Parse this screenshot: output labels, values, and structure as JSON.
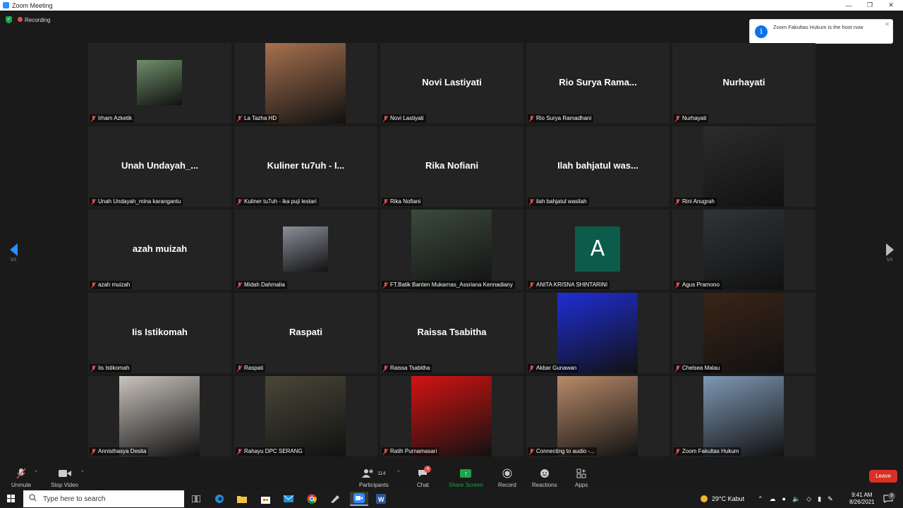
{
  "window": {
    "title": "Zoom Meeting"
  },
  "meeting": {
    "recording_label": "Recording",
    "notification": "Zoom Fakultas Hukum is the host now",
    "page_left": "5/5",
    "page_right": "5/5",
    "tiles": [
      {
        "label": "Irham Azketik",
        "big": "",
        "kind": "photo",
        "color": "#6f8f6a"
      },
      {
        "label": "La Tazha HD",
        "big": "",
        "kind": "video",
        "color": "#a7714f"
      },
      {
        "label": "Novi Lastiyati",
        "big": "Novi Lastiyati",
        "kind": "name",
        "color": ""
      },
      {
        "label": "Rio Surya Ramadhani",
        "big": "Rio Surya Rama...",
        "kind": "name",
        "color": ""
      },
      {
        "label": "Nurhayati",
        "big": "Nurhayati",
        "kind": "name",
        "color": ""
      },
      {
        "label": "Unah Undayah_mina karangantu",
        "big": "Unah Undayah_...",
        "kind": "name",
        "color": ""
      },
      {
        "label": "Kuliner tu7uh - ika puji lestari",
        "big": "Kuliner tu7uh - I...",
        "kind": "name",
        "color": ""
      },
      {
        "label": "Rika Nofiani",
        "big": "Rika Nofiani",
        "kind": "name",
        "color": ""
      },
      {
        "label": "ilah bahjatul wasilah",
        "big": "Ilah bahjatul was...",
        "kind": "name",
        "color": ""
      },
      {
        "label": "Rini Anugrah",
        "big": "",
        "kind": "video",
        "color": "#2c2c2c"
      },
      {
        "label": "azah muizah",
        "big": "azah muizah",
        "kind": "name",
        "color": ""
      },
      {
        "label": "Midah Dahmalia",
        "big": "",
        "kind": "photo",
        "color": "#8a8f9a"
      },
      {
        "label": "FT.Batik Banten Mukarnas_Assriana Kennadiany",
        "big": "",
        "kind": "video",
        "color": "#3b4a3c"
      },
      {
        "label": "ANITA KRISNA SHINTARINI",
        "big": "A",
        "kind": "avatar",
        "color": "#0b5c4a"
      },
      {
        "label": "Agus Pramono",
        "big": "",
        "kind": "video",
        "color": "#303438"
      },
      {
        "label": "Iis Istikomah",
        "big": "Iis Istikomah",
        "kind": "name",
        "color": ""
      },
      {
        "label": "Raspati",
        "big": "Raspati",
        "kind": "name",
        "color": ""
      },
      {
        "label": "Raissa Tsabitha",
        "big": "Raissa Tsabitha",
        "kind": "name",
        "color": ""
      },
      {
        "label": "Akbar Gunawan",
        "big": "",
        "kind": "video",
        "color": "#1f2ed6"
      },
      {
        "label": "Chelsea Malau",
        "big": "",
        "kind": "video",
        "color": "#3a2418"
      },
      {
        "label": "Annisthasya Desita",
        "big": "",
        "kind": "video",
        "color": "#c9c3bd"
      },
      {
        "label": "Rahayu DPC SERANG",
        "big": "",
        "kind": "video",
        "color": "#4a4738"
      },
      {
        "label": "Ratih Purnamasari",
        "big": "",
        "kind": "video",
        "color": "#d41313"
      },
      {
        "label": "Connecting to audio -...",
        "big": "",
        "kind": "video",
        "color": "#b88a6a"
      },
      {
        "label": "Zoom Fakultas Hukum",
        "big": "",
        "kind": "video",
        "color": "#7f98b4"
      }
    ]
  },
  "toolbar": {
    "unmute": "Unmute",
    "stop_video": "Stop Video",
    "participants": "Participants",
    "participants_count": "114",
    "chat": "Chat",
    "chat_badge": "4",
    "share_screen": "Share Screen",
    "record": "Record",
    "reactions": "Reactions",
    "apps": "Apps",
    "leave": "Leave"
  },
  "taskbar": {
    "search_placeholder": "Type here to search",
    "weather": "29°C  Kabut",
    "time": "9:41 AM",
    "date": "8/26/2021",
    "notif_count": "9"
  },
  "colors": {
    "accent": "#2d8cff",
    "share_green": "#1ea34a",
    "leave_red": "#d93025",
    "muted_red": "#e0534d"
  }
}
